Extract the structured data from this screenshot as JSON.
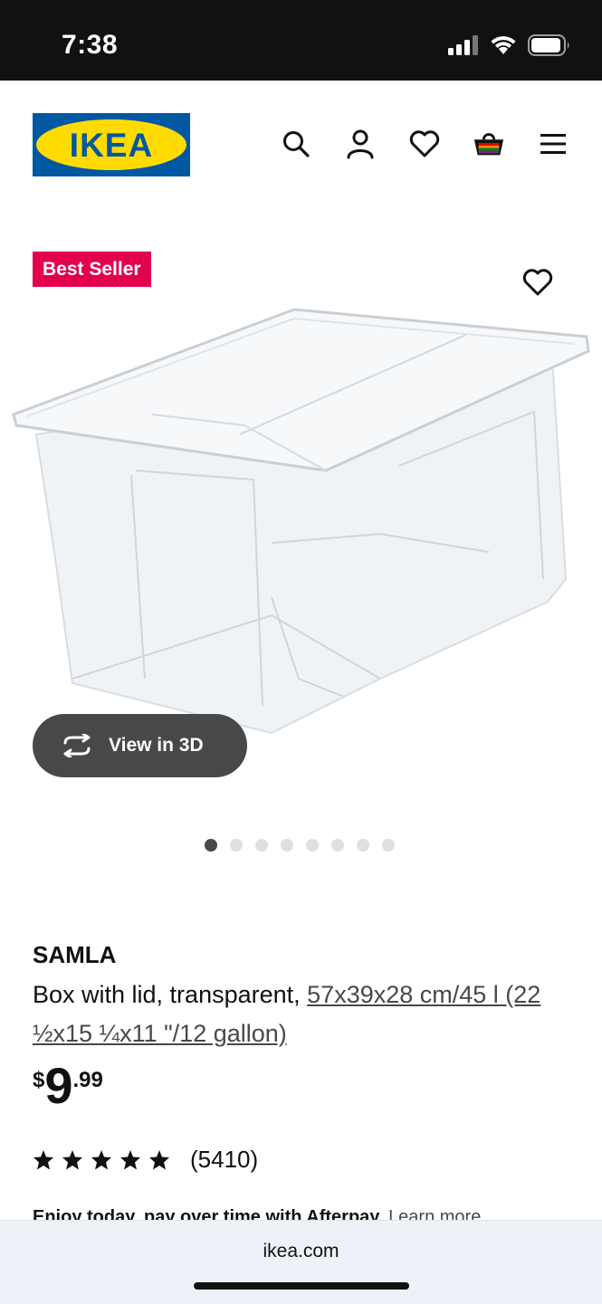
{
  "status": {
    "time": "7:38"
  },
  "brand": {
    "logo_text": "IKEA",
    "colors": {
      "blue": "#0058a3",
      "yellow": "#ffdb00"
    }
  },
  "header": {
    "icons": [
      "search-icon",
      "account-icon",
      "heart-icon",
      "cart-icon",
      "menu-icon"
    ]
  },
  "product": {
    "badge": "Best Seller",
    "view3d_label": "View in 3D",
    "gallery_count": 8,
    "gallery_active": 1,
    "name": "SAMLA",
    "description": "Box with lid, transparent, ",
    "size_link": "57x39x28 cm/45 l (22 ½x15 ¼x11 \"/12 gallon)",
    "price": {
      "currency": "$",
      "integer": "9",
      "decimal": ".99"
    },
    "rating": {
      "stars": 5,
      "count": "(5410)"
    },
    "afterpay_text": "Enjoy today, pay over time with Afterpay.",
    "afterpay_link": "Learn more"
  },
  "browser": {
    "url": "ikea.com"
  },
  "colors": {
    "badge": "#e3004f",
    "button_dark": "#484848"
  }
}
